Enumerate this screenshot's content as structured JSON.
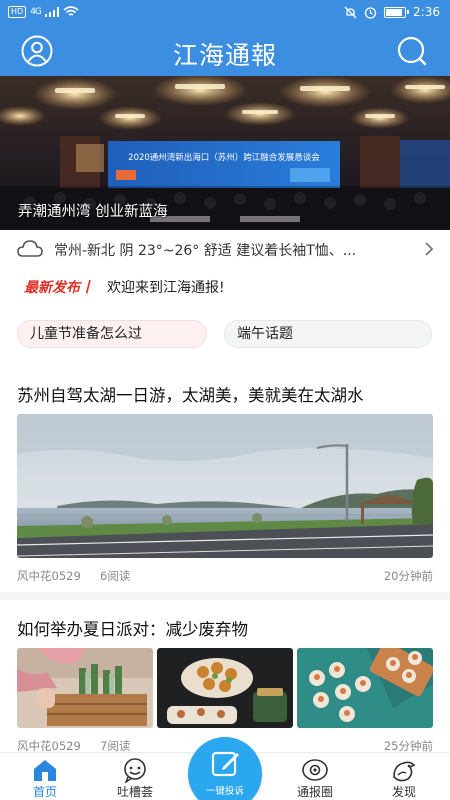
{
  "status_bar": {
    "network": "HD",
    "signal": "4G",
    "time": "2:36",
    "battery_level": 0.8
  },
  "header": {
    "title": "江海通報",
    "user_icon": "user-icon",
    "search_icon": "search-icon"
  },
  "banner": {
    "caption": "弄潮通州湾 创业新蓝海",
    "stage_text": "2020通州湾新出海口（苏州）跨江融合发展恳谈会"
  },
  "weather": {
    "icon": "cloud-icon",
    "text": "常州-新北 阴 23°~26° 舒适 建议着长袖T恤、..."
  },
  "announcement": {
    "badge": "最新发布丨",
    "text": "欢迎来到江海通报!"
  },
  "topics": [
    {
      "label": "儿童节准备怎么过"
    },
    {
      "label": "端午话题"
    }
  ],
  "articles": [
    {
      "title": "苏州自驾太湖一日游，太湖美，美就美在太湖水",
      "author": "风中花0529",
      "reads": "6阅读",
      "time": "20分钟前"
    },
    {
      "title": "如何举办夏日派对：减少废弃物",
      "author": "风中花0529",
      "reads": "7阅读",
      "time": "25分钟前"
    }
  ],
  "bottom_nav": {
    "home": "首页",
    "tucao": "吐槽荟",
    "complain": "一键投诉",
    "circle": "通报圈",
    "discover": "发现",
    "active_color": "#2b86e0",
    "accent": "#3c8ee0"
  }
}
